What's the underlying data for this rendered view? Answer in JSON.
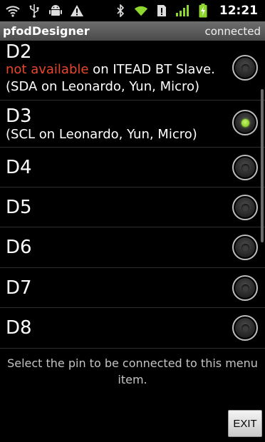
{
  "status_bar": {
    "left_icons": [
      "wifi-icon",
      "usb-icon",
      "android-icon",
      "warning-icon"
    ],
    "right_icons": [
      "bluetooth-icon",
      "wifi-signal-icon",
      "sim-alert-icon",
      "cell-signal-icon",
      "battery-charging-icon"
    ],
    "time": "12:21"
  },
  "title_bar": {
    "title": "pfodDesigner",
    "status": "connected"
  },
  "pins": [
    {
      "label": "D2",
      "warning": "not available",
      "warning_suffix": " on ITEAD BT Slave.",
      "note": "(SDA on Leonardo, Yun, Micro)",
      "selected": false
    },
    {
      "label": "D3",
      "note": "(SCL on Leonardo, Yun, Micro)",
      "selected": true
    },
    {
      "label": "D4",
      "selected": false
    },
    {
      "label": "D5",
      "selected": false
    },
    {
      "label": "D6",
      "selected": false
    },
    {
      "label": "D7",
      "selected": false
    },
    {
      "label": "D8",
      "selected": false
    }
  ],
  "footer": {
    "hint": "Select the pin to be connected to this menu item.",
    "exit_label": "EXIT"
  },
  "colors": {
    "warning": "#e8472a",
    "selected_radio": "#8cd02a",
    "title_bar": "#5a5a5a"
  }
}
